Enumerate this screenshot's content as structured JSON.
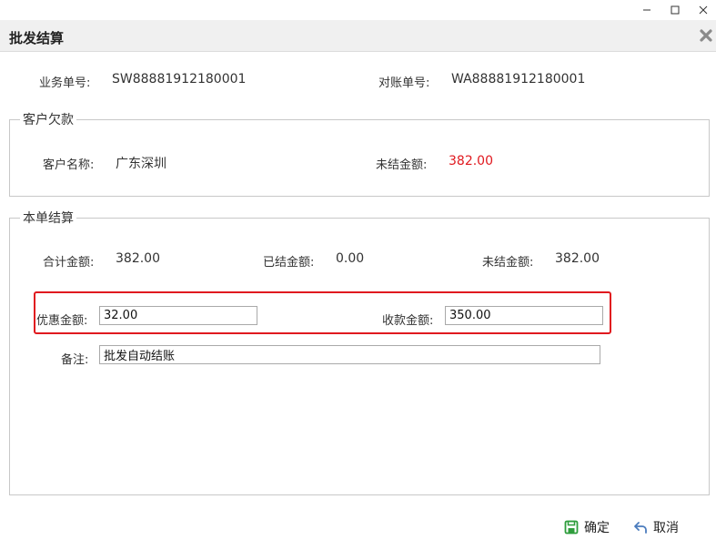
{
  "window": {
    "title": "批发结算",
    "controls": {
      "minimize_icon": "minimize-icon",
      "maximize_icon": "maximize-icon",
      "close_icon": "close-icon"
    }
  },
  "header_fields": {
    "business_no_label": "业务单号:",
    "business_no": "SW88881912180001",
    "reconcile_no_label": "对账单号:",
    "reconcile_no": "WA88881912180001"
  },
  "customer_debt": {
    "legend": "客户欠款",
    "customer_name_label": "客户名称:",
    "customer_name": "广东深圳",
    "unsettled_label": "未结金额:",
    "unsettled_amount": "382.00"
  },
  "settlement": {
    "legend": "本单结算",
    "total_label": "合计金额:",
    "total_amount": "382.00",
    "settled_label": "已结金额:",
    "settled_amount": "0.00",
    "unsettled_label": "未结金额:",
    "unsettled_amount": "382.00",
    "discount_label": "优惠金额:",
    "discount_value": "32.00",
    "received_label": "收款金额:",
    "received_value": "350.00",
    "remark_label": "备注:",
    "remark_value": "批发自动结账"
  },
  "actions": {
    "confirm_label": "确定",
    "cancel_label": "取消"
  },
  "colors": {
    "accent_red": "#e0191f",
    "confirm_icon": "#2e9d3c",
    "cancel_icon": "#4a7bbd"
  }
}
